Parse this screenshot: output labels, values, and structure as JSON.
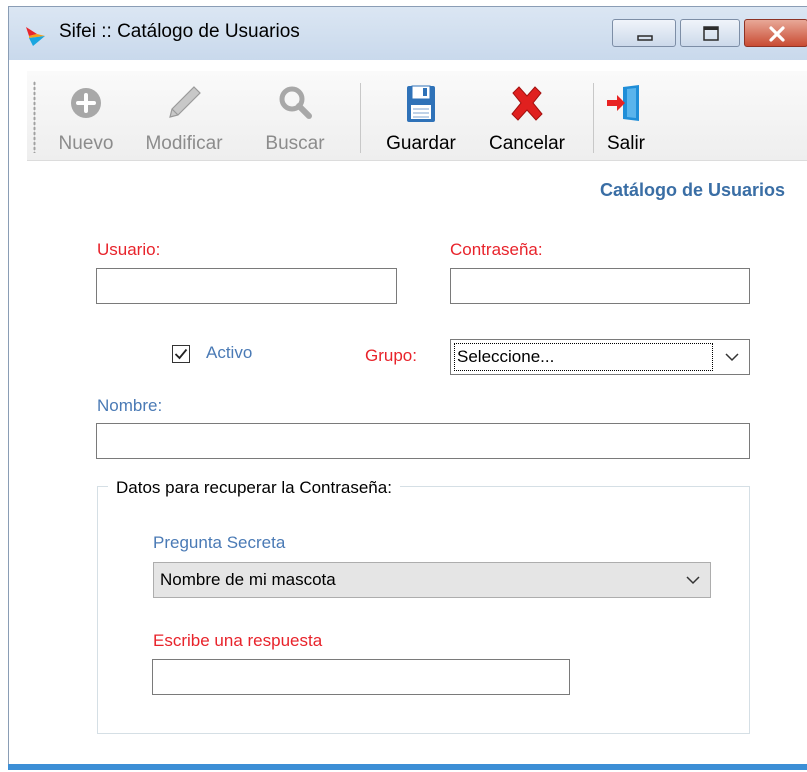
{
  "window": {
    "title": "Sifei :: Catálogo de Usuarios",
    "icons": {
      "app": "sifei-logo-icon",
      "minimize": "minimize-icon",
      "maximize": "maximize-icon",
      "close": "close-icon"
    }
  },
  "toolbar": {
    "items": [
      {
        "label": "Nuevo",
        "icon": "plus-circle-icon",
        "enabled": false
      },
      {
        "label": "Modificar",
        "icon": "pencil-icon",
        "enabled": false
      },
      {
        "label": "Buscar",
        "icon": "magnifier-icon",
        "enabled": false
      },
      {
        "label": "Guardar",
        "icon": "floppy-disk-icon",
        "enabled": true
      },
      {
        "label": "Cancelar",
        "icon": "red-x-icon",
        "enabled": true
      },
      {
        "label": "Salir",
        "icon": "exit-door-icon",
        "enabled": true
      }
    ]
  },
  "form": {
    "section_title": "Catálogo de Usuarios",
    "usuario": {
      "label": "Usuario:",
      "value": ""
    },
    "contrasena": {
      "label": "Contraseña:",
      "value": ""
    },
    "activo": {
      "label": "Activo",
      "checked": true
    },
    "grupo": {
      "label": "Grupo:",
      "selected": "Seleccione..."
    },
    "nombre": {
      "label": "Nombre:",
      "value": ""
    },
    "recovery": {
      "legend": "Datos para recuperar la Contraseña:",
      "pregunta": {
        "label": "Pregunta Secreta",
        "selected": "Nombre de mi mascota"
      },
      "respuesta": {
        "label": "Escribe una respuesta",
        "value": ""
      }
    }
  },
  "colors": {
    "required_label": "#e8232b",
    "optional_label": "#4a7ab5",
    "section_title": "#3a6ea5",
    "accent_bar": "#3c8fd6"
  }
}
